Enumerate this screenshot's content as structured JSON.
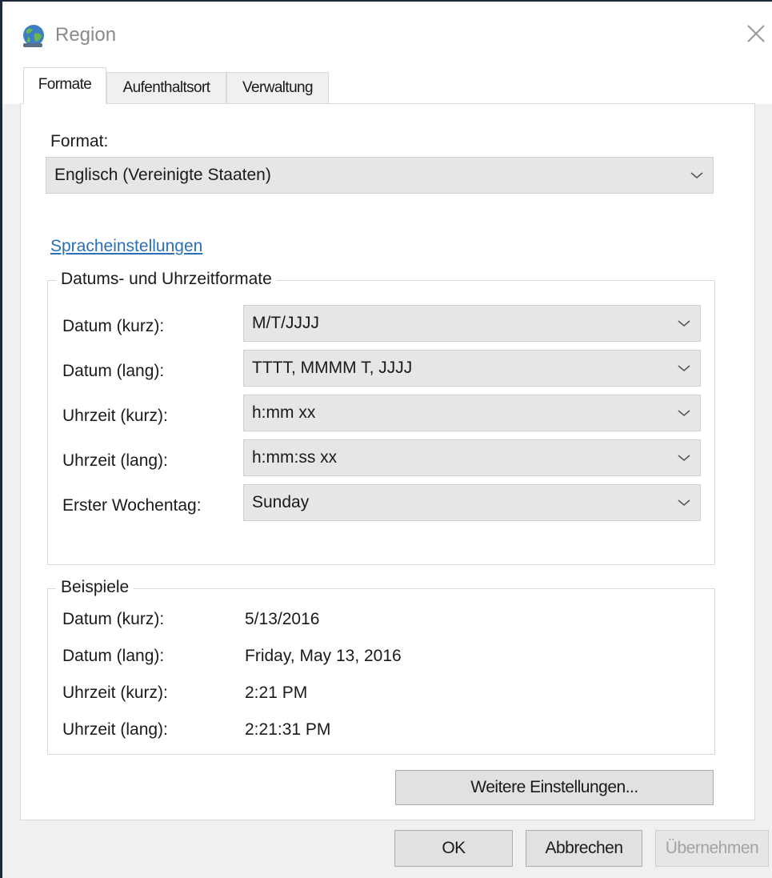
{
  "window": {
    "title": "Region"
  },
  "tabs": [
    {
      "label": "Formate",
      "active": true
    },
    {
      "label": "Aufenthaltsort",
      "active": false
    },
    {
      "label": "Verwaltung",
      "active": false
    }
  ],
  "format": {
    "label": "Format:",
    "selected": "Englisch (Vereinigte Staaten)"
  },
  "language_link": "Spracheinstellungen",
  "datetime_formats": {
    "heading": "Datums- und Uhrzeitformate",
    "rows": [
      {
        "label": "Datum (kurz):",
        "value": "M/T/JJJJ"
      },
      {
        "label": "Datum (lang):",
        "value": "TTTT, MMMM T, JJJJ"
      },
      {
        "label": "Uhrzeit (kurz):",
        "value": "h:mm xx"
      },
      {
        "label": "Uhrzeit (lang):",
        "value": "h:mm:ss xx"
      },
      {
        "label": "Erster Wochentag:",
        "value": "Sunday"
      }
    ]
  },
  "examples": {
    "heading": "Beispiele",
    "rows": [
      {
        "label": "Datum (kurz):",
        "value": "5/13/2016"
      },
      {
        "label": "Datum (lang):",
        "value": "Friday, May 13, 2016"
      },
      {
        "label": "Uhrzeit (kurz):",
        "value": "2:21 PM"
      },
      {
        "label": "Uhrzeit (lang):",
        "value": "2:21:31 PM"
      }
    ]
  },
  "buttons": {
    "more_settings": "Weitere Einstellungen...",
    "ok": "OK",
    "cancel": "Abbrechen",
    "apply": "Übernehmen"
  },
  "icons": {
    "title": "globe-icon",
    "close": "close-icon",
    "dropdown": "chevron-down-icon"
  },
  "colors": {
    "link": "#2b6fb5",
    "window_bg": "#f0f0f0",
    "panel_bg": "#ffffff",
    "combo_bg": "#e6e6e6",
    "disabled_text": "#a3a3a3"
  }
}
